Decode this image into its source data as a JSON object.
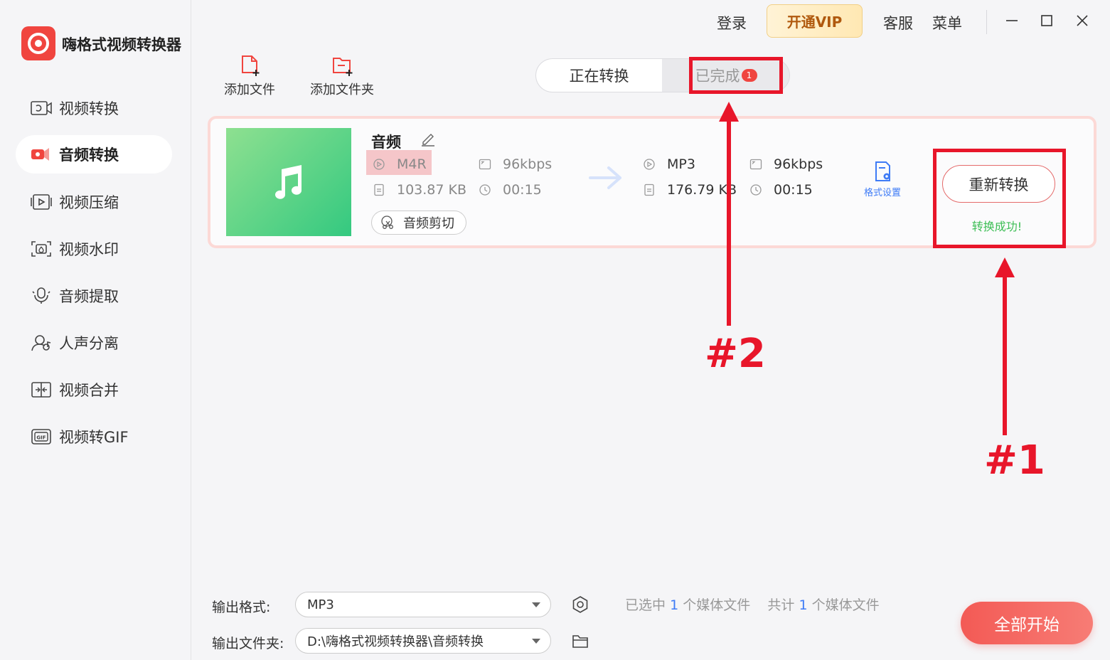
{
  "app": {
    "title": "嗨格式视频转换器"
  },
  "topbar": {
    "login": "登录",
    "vip": "开通VIP",
    "service": "客服",
    "menu": "菜单"
  },
  "sidebar": {
    "items": [
      {
        "label": "视频转换",
        "icon": "video-convert-icon"
      },
      {
        "label": "音频转换",
        "icon": "audio-convert-icon",
        "active": true
      },
      {
        "label": "视频压缩",
        "icon": "video-compress-icon"
      },
      {
        "label": "视频水印",
        "icon": "video-watermark-icon"
      },
      {
        "label": "音频提取",
        "icon": "audio-extract-icon"
      },
      {
        "label": "人声分离",
        "icon": "vocal-separation-icon"
      },
      {
        "label": "视频合并",
        "icon": "video-merge-icon"
      },
      {
        "label": "视频转GIF",
        "icon": "video-gif-icon"
      }
    ]
  },
  "toolbar": {
    "add_file": "添加文件",
    "add_folder": "添加文件夹"
  },
  "tabs": {
    "converting": "正在转换",
    "done": "已完成",
    "done_count": "1"
  },
  "task": {
    "name": "音频",
    "source": {
      "format": "M4R",
      "bitrate": "96kbps",
      "size": "103.87 KB",
      "duration": "00:15"
    },
    "target": {
      "format": "MP3",
      "bitrate": "96kbps",
      "size": "176.79 KB",
      "duration": "00:15"
    },
    "clip_label": "音频剪切",
    "format_settings": "格式设置",
    "reconvert": "重新转换",
    "status": "转换成功!"
  },
  "annotations": {
    "label1": "#1",
    "label2": "#2"
  },
  "bottom": {
    "output_format_label": "输出格式:",
    "output_format_value": "MP3",
    "output_folder_label": "输出文件夹:",
    "output_folder_value": "D:\\嗨格式视频转换器\\音频转换",
    "selected_prefix": "已选中",
    "selected_count": "1",
    "selected_suffix": "个媒体文件",
    "total_prefix": "共计",
    "total_count": "1",
    "total_suffix": "个媒体文件",
    "start_all": "全部开始"
  },
  "colors": {
    "accent": "#f0453f",
    "annotation": "#e8162a",
    "success": "#3dbe55",
    "link": "#3e7bf6"
  }
}
